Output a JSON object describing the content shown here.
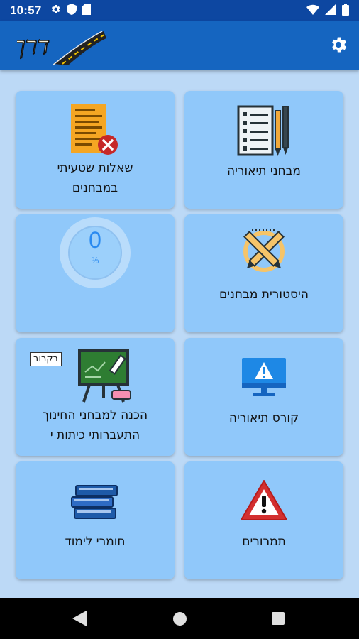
{
  "status_bar": {
    "time": "10:57"
  },
  "app_bar": {
    "logo_text": "דרך"
  },
  "tiles": {
    "theory_exams": {
      "label": "מבחני תיאוריה"
    },
    "wrong_answers": {
      "label_line1": "שאלות שטעיתי",
      "label_line2": "במבחנים"
    },
    "exam_history": {
      "label": "היסטורית מבחנים"
    },
    "progress": {
      "value": "0",
      "unit": "%"
    },
    "theory_course": {
      "label": "קורס תיאוריה"
    },
    "ministry_exam_prep": {
      "badge": "בקרוב",
      "label_line1": "הכנה למבחני החינוך",
      "label_line2": "התעברותי כיתות י"
    },
    "road_signs": {
      "label": "תמרורים"
    },
    "study_materials": {
      "label": "חומרי לימוד"
    }
  },
  "colors": {
    "status_bar": "#0d47a1",
    "app_bar": "#1565c0",
    "background": "#bcd9f6",
    "tile": "#90c8fa",
    "nav_bar": "#000000"
  }
}
